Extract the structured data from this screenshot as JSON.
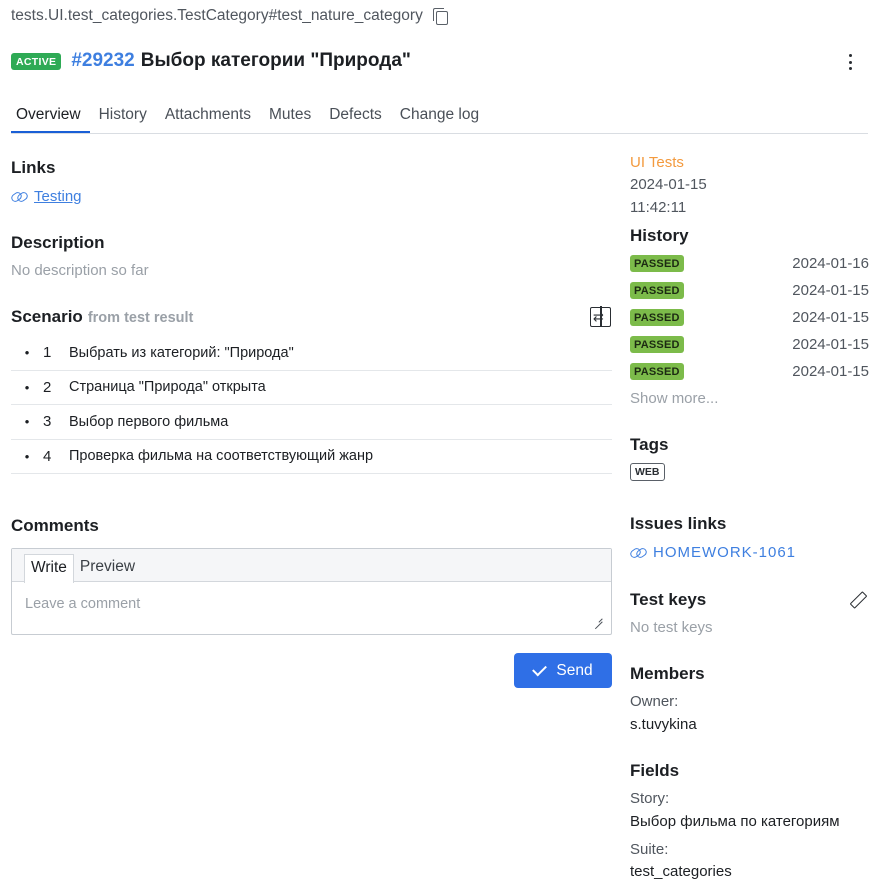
{
  "header": {
    "path": "tests.UI.test_categories.TestCategory#test_nature_category",
    "status_badge": "ACTIVE",
    "test_id": "#29232",
    "title": "Выбор категории \"Природа\""
  },
  "tabs": [
    {
      "label": "Overview",
      "active": true
    },
    {
      "label": "History",
      "active": false
    },
    {
      "label": "Attachments",
      "active": false
    },
    {
      "label": "Mutes",
      "active": false
    },
    {
      "label": "Defects",
      "active": false
    },
    {
      "label": "Change log",
      "active": false
    }
  ],
  "links": {
    "heading": "Links",
    "items": [
      {
        "label": "Testing"
      }
    ]
  },
  "description": {
    "heading": "Description",
    "text": "No description so far"
  },
  "scenario": {
    "heading": "Scenario",
    "subheading": "from test result",
    "steps": [
      {
        "num": "1",
        "text": "Выбрать из категорий: \"Природа\""
      },
      {
        "num": "2",
        "text": "Страница \"Природа\" открыта"
      },
      {
        "num": "3",
        "text": "Выбор первого фильма"
      },
      {
        "num": "4",
        "text": "Проверка фильма на соответствующий жанр"
      }
    ]
  },
  "comments": {
    "heading": "Comments",
    "tab_write": "Write",
    "tab_preview": "Preview",
    "placeholder": "Leave a comment",
    "send_label": "Send"
  },
  "sidebar": {
    "launch_name": "UI Tests",
    "date": "2024-01-15",
    "time": "11:42:11",
    "history": {
      "heading": "History",
      "items": [
        {
          "status": "PASSED",
          "date": "2024-01-16"
        },
        {
          "status": "PASSED",
          "date": "2024-01-15"
        },
        {
          "status": "PASSED",
          "date": "2024-01-15"
        },
        {
          "status": "PASSED",
          "date": "2024-01-15"
        },
        {
          "status": "PASSED",
          "date": "2024-01-15"
        }
      ],
      "show_more": "Show more..."
    },
    "tags": {
      "heading": "Tags",
      "items": [
        "WEB"
      ]
    },
    "issues": {
      "heading": "Issues links",
      "items": [
        "HOMEWORK-1061"
      ]
    },
    "test_keys": {
      "heading": "Test keys",
      "empty": "No test keys"
    },
    "members": {
      "heading": "Members",
      "owner_label": "Owner:",
      "owner_value": "s.tuvykina"
    },
    "fields": {
      "heading": "Fields",
      "story_label": "Story:",
      "story_value": "Выбор фильма по категориям",
      "suite_label": "Suite:",
      "suite_value": "test_categories"
    }
  },
  "colors": {
    "accent": "#3e7fe0",
    "active_badge": "#2eaa55",
    "passed_badge": "#7cbb4a",
    "send_button": "#2f6fe6",
    "launch_link": "#f39a3e"
  },
  "icons": {
    "copy": "copy-icon",
    "kebab": "more-vertical-icon",
    "link": "link-icon",
    "swap": "swap-panel-icon",
    "check": "check-icon",
    "pencil": "pencil-icon",
    "resize": "resize-grip-icon"
  }
}
